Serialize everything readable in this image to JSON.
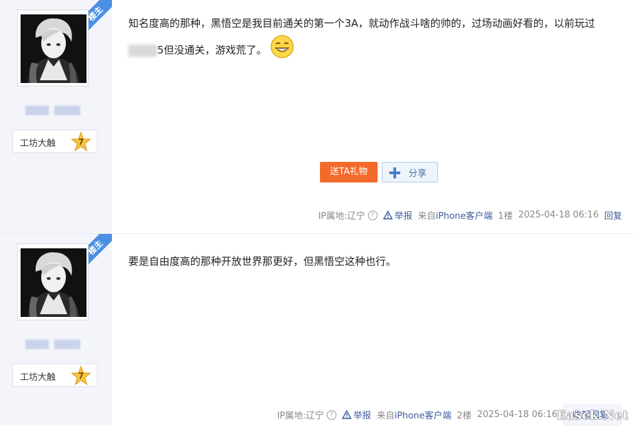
{
  "posts": [
    {
      "ribbon": "楼主",
      "level_name": "工坊大触",
      "level": "7",
      "content_before": "知名度高的那种，黑悟空是我目前通关的第一个3A，就动作战斗啥的帅的，过场动画好看的，以前玩过",
      "content_after": "5但没通关，游戏荒了。",
      "gift_label": "送TA礼物",
      "share_label": "分享",
      "ip_label": "IP属地:辽宁",
      "report_label": "举报",
      "source_prefix": "来自",
      "source_link": "iPhone客户端",
      "floor": "1楼",
      "time": "2025-04-18 06:16",
      "reply_label": "回复"
    },
    {
      "ribbon": "楼主",
      "level_name": "工坊大触",
      "level": "7",
      "content": "要是自由度高的那种开放世界那更好，但黑悟空这种也行。",
      "ip_label": "IP属地:辽宁",
      "report_label": "举报",
      "source_prefix": "来自",
      "source_link": "iPhone客户端",
      "floor": "2楼",
      "time": "2025-04-18 06:16",
      "reply_label": "收起回复"
    }
  ],
  "watermark": "Easck.Net",
  "colors": {
    "ribbon": "#4a8fe4",
    "gift": "#f46a2b",
    "link": "#3a5c9c",
    "sidebar": "#f4f5fb"
  }
}
